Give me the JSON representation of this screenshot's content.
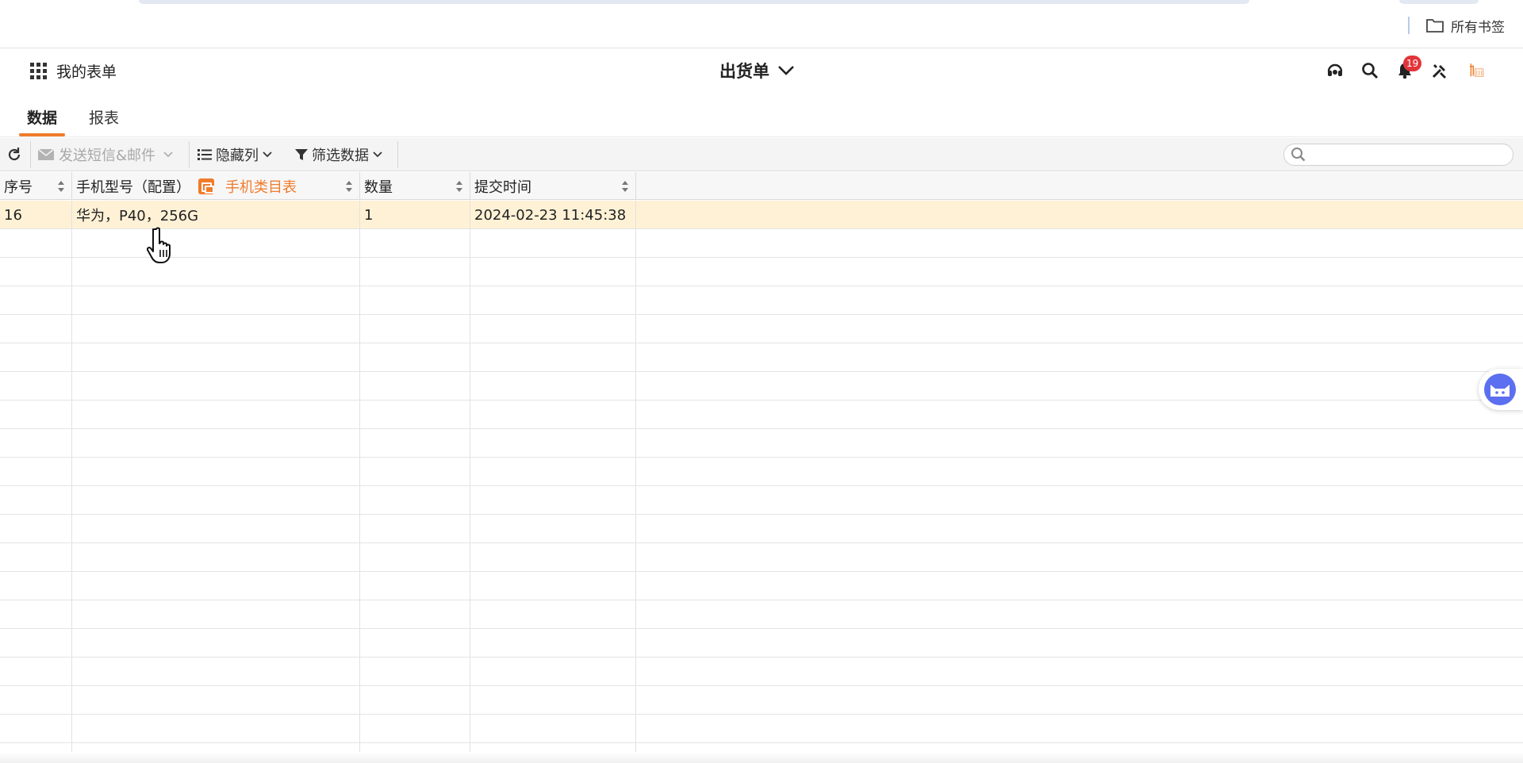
{
  "browser": {
    "all_bookmarks": "所有书签"
  },
  "header": {
    "my_forms": "我的表单",
    "form_title": "出货单",
    "notification_count": "19"
  },
  "tabs": [
    {
      "label": "数据",
      "active": true
    },
    {
      "label": "报表",
      "active": false
    }
  ],
  "toolbar": {
    "send_label": "发送短信&邮件",
    "hide_columns_label": "隐藏列",
    "filter_label": "筛选数据",
    "search_placeholder": ""
  },
  "table": {
    "columns": [
      {
        "label": "序号"
      },
      {
        "label": "手机型号（配置）"
      },
      {
        "label": "手机类目表"
      },
      {
        "label": "数量"
      },
      {
        "label": "提交时间"
      }
    ],
    "rows": [
      [
        "16",
        "华为，P40，256G",
        "1",
        "2024-02-23 11:45:38"
      ]
    ]
  },
  "colors": {
    "accent": "#f07c2c",
    "selected_row": "#fff1d6",
    "badge": "#e2353a"
  }
}
